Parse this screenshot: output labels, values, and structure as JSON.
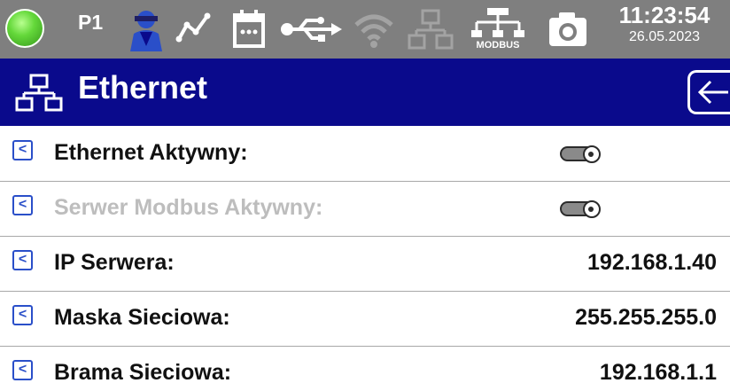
{
  "status_bar": {
    "profile": "P1",
    "modbus_label": "MODBUS",
    "time": "11:23:54",
    "date": "26.05.2023",
    "icons": [
      "status-led-icon",
      "user-icon",
      "trend-icon",
      "calendar-icon",
      "usb-icon",
      "wifi-icon",
      "network-icon",
      "modbus-icon",
      "camera-icon"
    ]
  },
  "header": {
    "icon": "network-icon",
    "title": "Ethernet",
    "back_icon": "back-arrow-icon"
  },
  "rows": [
    {
      "label": "Ethernet Aktywny:",
      "type": "toggle",
      "value": "off",
      "enabled": true
    },
    {
      "label": "Serwer Modbus Aktywny:",
      "type": "toggle",
      "value": "off",
      "enabled": false
    },
    {
      "label": "IP Serwera:",
      "type": "text",
      "value": "192.168.1.40",
      "enabled": true
    },
    {
      "label": "Maska Sieciowa:",
      "type": "text",
      "value": "255.255.255.0",
      "enabled": true
    },
    {
      "label": "Brama Sieciowa:",
      "type": "text",
      "value": "192.168.1.1",
      "enabled": true
    }
  ],
  "row_button_glyph": "<",
  "colors": {
    "status_bar": "#7f7f7f",
    "header": "#0a0a8c",
    "accent_blue": "#2a4fc9",
    "disabled_text": "#bdbdbd"
  }
}
